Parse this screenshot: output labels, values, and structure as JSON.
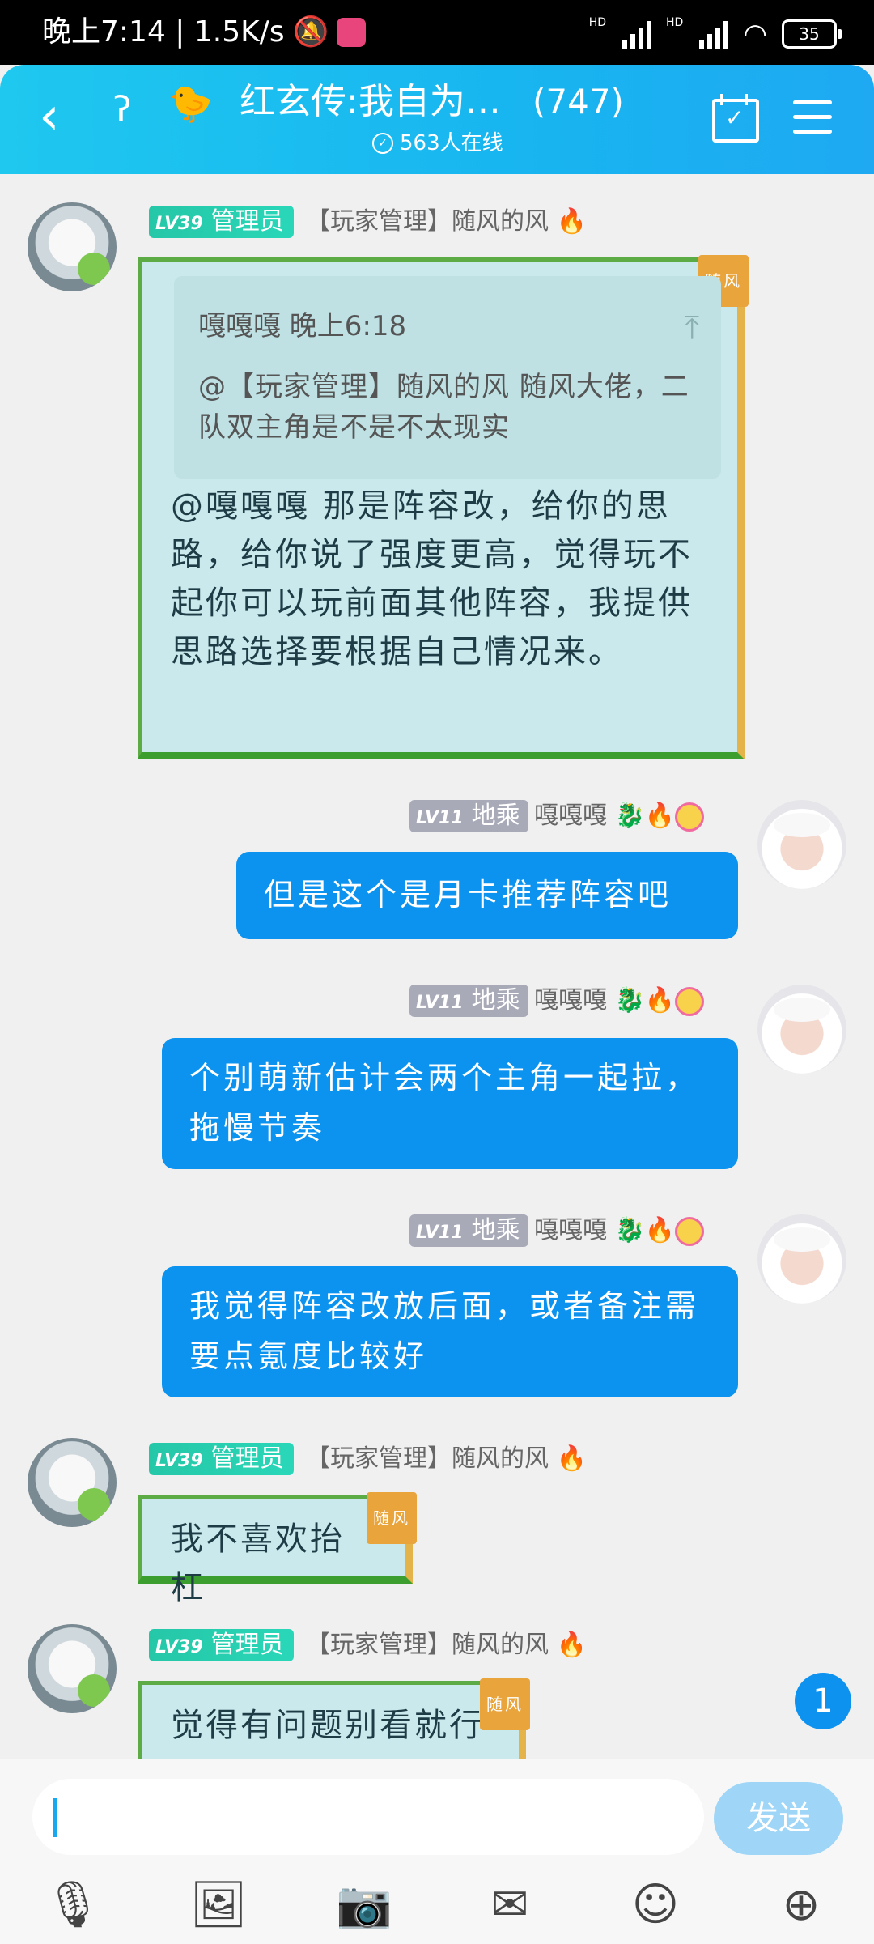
{
  "status_bar": {
    "time_speed": "晚上7:14 | 1.5K/s",
    "battery": "35"
  },
  "header": {
    "back": "‹",
    "title": "红玄传:我自为…",
    "member_count": "(747)",
    "online": "563人在线"
  },
  "messages": [
    {
      "side": "left",
      "level": "LV39",
      "role": "管理员",
      "nick": "【玩家管理】随风的风",
      "tag": "随风",
      "quote": {
        "author_time": "嘎嘎嘎 晚上6:18",
        "text": "@【玩家管理】随风的风 随风大佬，二队双主角是不是不太现实"
      },
      "text": "@嘎嘎嘎 那是阵容改，给你的思路，给你说了强度更高，觉得玩不起你可以玩前面其他阵容，我提供思路选择要根据自己情况来。"
    },
    {
      "side": "right",
      "level": "LV11",
      "role": "地乘",
      "nick": "嘎嘎嘎",
      "text": "但是这个是月卡推荐阵容吧"
    },
    {
      "side": "right",
      "level": "LV11",
      "role": "地乘",
      "nick": "嘎嘎嘎",
      "text": "个别萌新估计会两个主角一起拉，拖慢节奏"
    },
    {
      "side": "right",
      "level": "LV11",
      "role": "地乘",
      "nick": "嘎嘎嘎",
      "text": "我觉得阵容改放后面，或者备注需要点氪度比较好"
    },
    {
      "side": "left",
      "level": "LV39",
      "role": "管理员",
      "nick": "【玩家管理】随风的风",
      "tag": "随风",
      "text": "我不喜欢抬杠"
    },
    {
      "side": "left",
      "level": "LV39",
      "role": "管理员",
      "nick": "【玩家管理】随风的风",
      "tag": "随风",
      "text": "觉得有问题别看就行"
    }
  ],
  "unread_badge": "1",
  "input": {
    "value": "",
    "send_label": "发送"
  },
  "icons": [
    "mic-icon",
    "image-icon",
    "camera-icon",
    "red-packet-icon",
    "emoji-icon",
    "plus-icon"
  ],
  "colors": {
    "header": "#18b5f0",
    "my_bubble": "#0b93ef",
    "admin_badge": "#25c7a7",
    "send_button": "#9fd6f7"
  }
}
